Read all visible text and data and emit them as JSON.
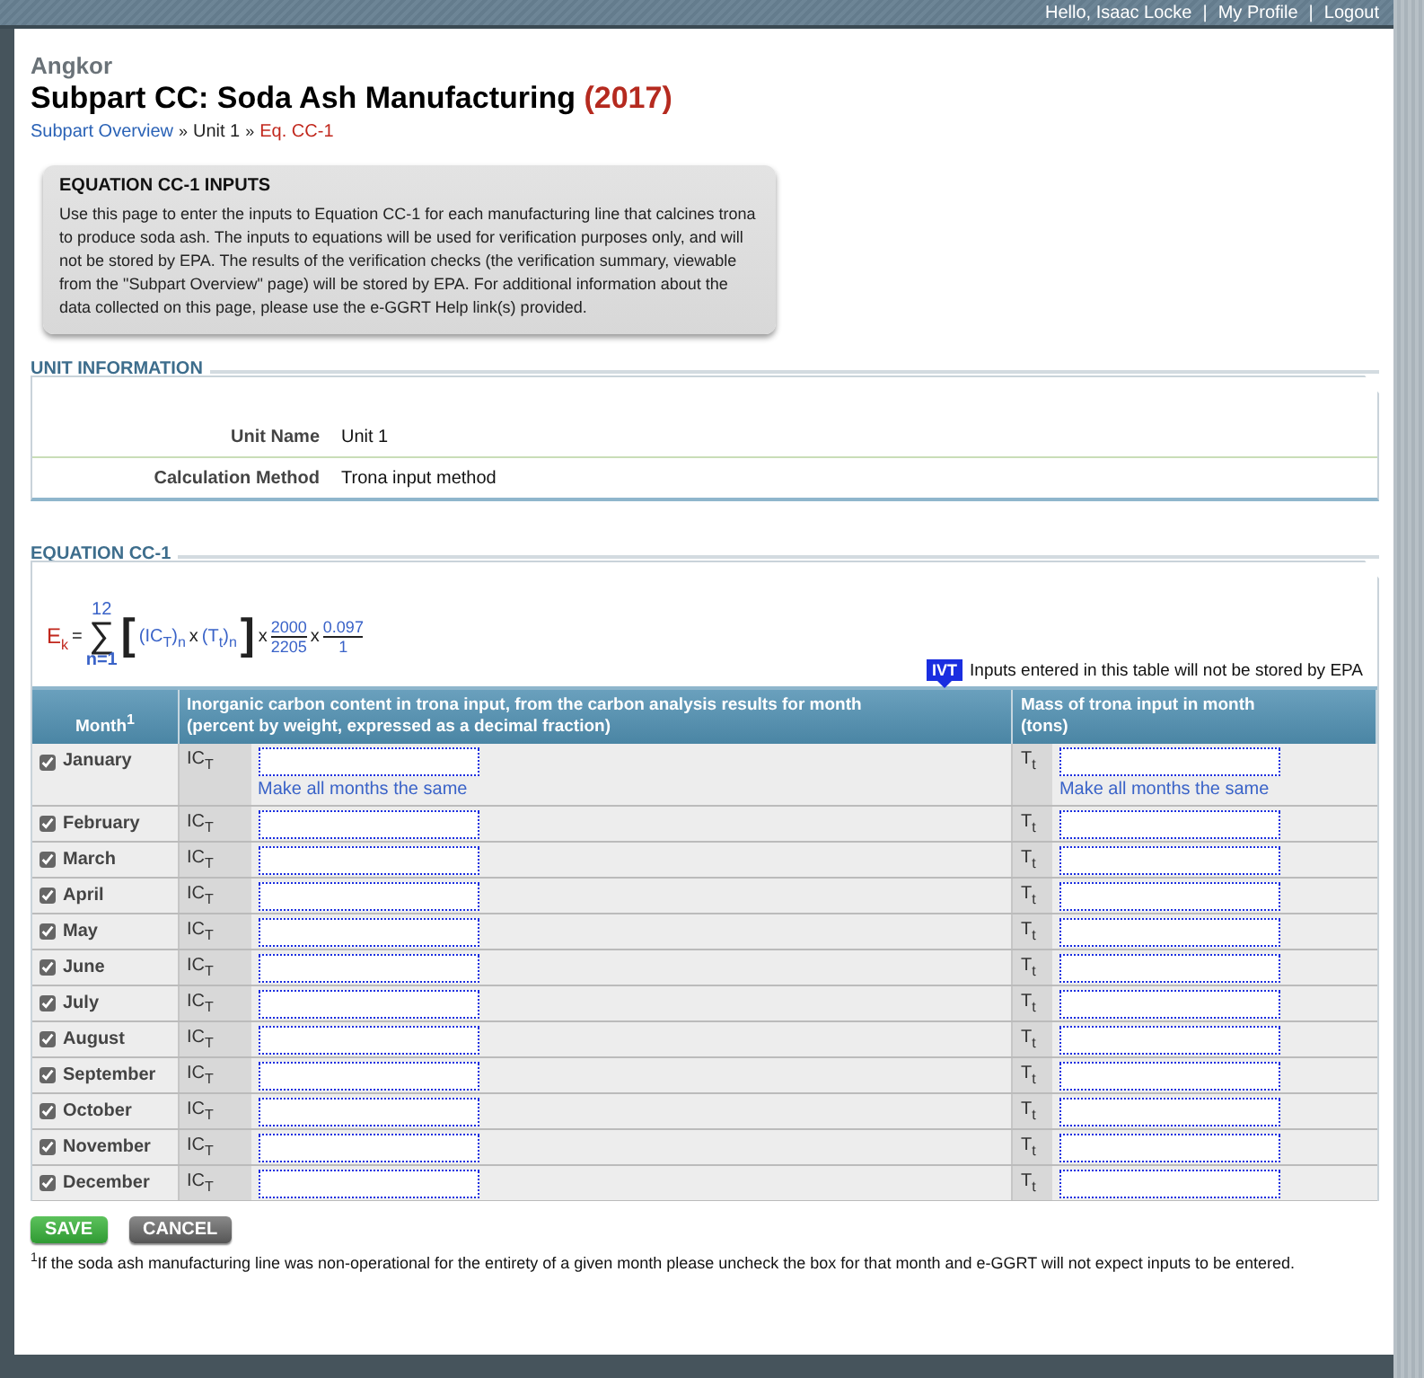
{
  "top_bar": {
    "greeting": "Hello, Isaac Locke",
    "separator_1": "|",
    "profile_link": "My Profile",
    "separator_2": "|",
    "logout_link": "Logout"
  },
  "header": {
    "facility": "Angkor",
    "title": "Subpart CC: Soda Ash Manufacturing",
    "year": "(2017)",
    "breadcrumb": [
      {
        "label": "Subpart Overview",
        "kind": "link"
      },
      {
        "label": "»",
        "kind": "sep"
      },
      {
        "label": "Unit 1",
        "kind": "plain"
      },
      {
        "label": "»",
        "kind": "sep"
      },
      {
        "label": "Eq. CC-1",
        "kind": "current"
      }
    ]
  },
  "info_box": {
    "title": "EQUATION CC-1 INPUTS",
    "text": "Use this page to enter the inputs to Equation CC-1 for each manufacturing line that calcines trona to produce soda ash. The inputs to equations will be used for verification purposes only, and will not be stored by EPA. The results of the verification checks (the verification summary, viewable from the \"Subpart Overview\" page) will be stored by EPA. For additional information about the data collected on this page, please use the e-GGRT Help link(s) provided."
  },
  "unit_information": {
    "legend": "UNIT INFORMATION",
    "fields": [
      {
        "label": "Unit Name",
        "value": "Unit 1"
      },
      {
        "label": "Calculation Method",
        "value": "Trona input method"
      }
    ]
  },
  "equation_section": {
    "legend": "EQUATION CC-1",
    "equation": {
      "lhs": "E$_{k}$",
      "equals": "=",
      "sum_upper": "12",
      "sum_symbol": "∑",
      "sum_lower": "n=1",
      "bracket_open": "[",
      "term_1": "(IC$_{T}$)$_{n}$",
      "times_1": "x",
      "term_2": "(T$_{t}$)$_{n}$",
      "bracket_close": "]",
      "times_2": "x",
      "fraction_1": {
        "numerator": "2000",
        "denominator": "2205"
      },
      "times_3": "x",
      "fraction_2": {
        "numerator": "0.097",
        "denominator": "1"
      }
    },
    "note": {
      "badge": "IVT",
      "text": "Inputs entered in this table will not be stored by EPA"
    },
    "table": {
      "columns": [
        "Month$^{1}$",
        "Inorganic carbon content in trona input, from the carbon analysis results for month\n(percent by weight, expressed as a decimal fraction)",
        "Mass of trona input in month\n(tons)"
      ],
      "rows": [
        {
          "month": "January",
          "checked": true,
          "ic_label": "IC$_{T}$",
          "t_label": "T$_{t}$",
          "ic_link": "Make all months the same",
          "t_link": "Make all months the same"
        },
        {
          "month": "February",
          "checked": true,
          "ic_label": "IC$_{T}$",
          "t_label": "T$_{t}$"
        },
        {
          "month": "March",
          "checked": true,
          "ic_label": "IC$_{T}$",
          "t_label": "T$_{t}$"
        },
        {
          "month": "April",
          "checked": true,
          "ic_label": "IC$_{T}$",
          "t_label": "T$_{t}$"
        },
        {
          "month": "May",
          "checked": true,
          "ic_label": "IC$_{T}$",
          "t_label": "T$_{t}$"
        },
        {
          "month": "June",
          "checked": true,
          "ic_label": "IC$_{T}$",
          "t_label": "T$_{t}$"
        },
        {
          "month": "July",
          "checked": true,
          "ic_label": "IC$_{T}$",
          "t_label": "T$_{t}$"
        },
        {
          "month": "August",
          "checked": true,
          "ic_label": "IC$_{T}$",
          "t_label": "T$_{t}$"
        },
        {
          "month": "September",
          "checked": true,
          "ic_label": "IC$_{T}$",
          "t_label": "T$_{t}$"
        },
        {
          "month": "October",
          "checked": true,
          "ic_label": "IC$_{T}$",
          "t_label": "T$_{t}$"
        },
        {
          "month": "November",
          "checked": true,
          "ic_label": "IC$_{T}$",
          "t_label": "T$_{t}$"
        },
        {
          "month": "December",
          "checked": true,
          "ic_label": "IC$_{T}$",
          "t_label": "T$_{t}$"
        }
      ]
    }
  },
  "buttons": [
    {
      "label": "SAVE",
      "kind": "primary"
    },
    {
      "label": "CANCEL",
      "kind": "secondary"
    }
  ],
  "footnote": "$^{1}$If the soda ash manufacturing line was non-operational for the entirety of a given month please uncheck the box for that month and e-GGRT will not expect inputs to be entered."
}
